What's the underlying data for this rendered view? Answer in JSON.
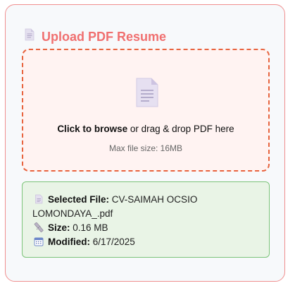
{
  "upload": {
    "title": "Upload PDF Resume",
    "title_icon": "document-icon",
    "dropzone": {
      "icon": "document-icon",
      "browse_label": "Click to browse",
      "rest_label": " or drag & drop PDF here",
      "max_size_text": "Max file size: 16MB"
    },
    "selected_file": {
      "file_label": "Selected File:",
      "file_name_line1": " CV-SAIMAH OCSIO",
      "file_name_line2": "LOMONDAYA_.pdf",
      "size_label": "Size:",
      "size_value": " 0.16 MB",
      "modified_label": "Modified:",
      "modified_value": " 6/17/2025"
    }
  },
  "colors": {
    "accent": "#f07070",
    "dropzone_border": "#e8633e",
    "dropzone_bg": "#fff3f2",
    "success_border": "#7cc47a",
    "success_bg": "#e9f4e6"
  }
}
